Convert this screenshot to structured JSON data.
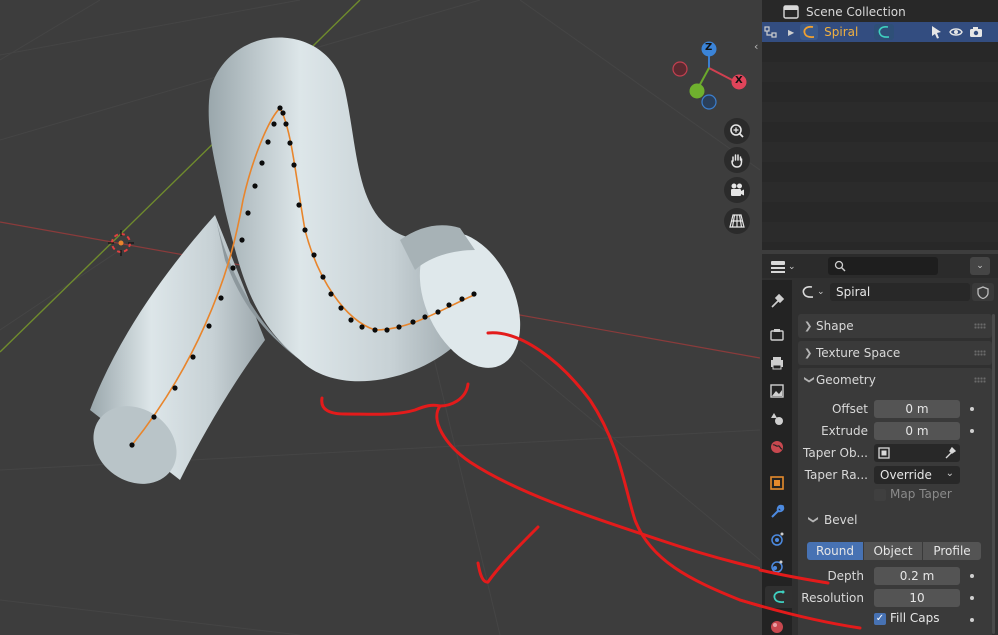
{
  "outliner": {
    "scene_collection_label": "Scene Collection",
    "object_name": "Spiral"
  },
  "properties": {
    "object_name": "Spiral",
    "search_placeholder": "",
    "panels": {
      "shape": "Shape",
      "texture_space": "Texture Space",
      "geometry": "Geometry",
      "bevel": "Bevel"
    },
    "geometry": {
      "offset_label": "Offset",
      "offset_value": "0 m",
      "extrude_label": "Extrude",
      "extrude_value": "0 m",
      "taper_object_label": "Taper Ob...",
      "taper_radius_label": "Taper Ra...",
      "taper_radius_value": "Override",
      "map_taper_label": "Map Taper"
    },
    "bevel": {
      "modes": [
        "Round",
        "Object",
        "Profile"
      ],
      "active_mode": "Round",
      "depth_label": "Depth",
      "depth_value": "0.2 m",
      "resolution_label": "Resolution",
      "resolution_value": "10",
      "fill_caps_label": "Fill Caps",
      "fill_caps_checked": true
    }
  },
  "gizmo": {
    "z_label": "Z",
    "x_label": "X"
  },
  "colors": {
    "viewport_bg": "#3d3d3d",
    "selected_row": "#334d80",
    "active_segment": "#4772b3",
    "curve_orange": "#e8852c",
    "annotation_red": "#e31b1b"
  }
}
